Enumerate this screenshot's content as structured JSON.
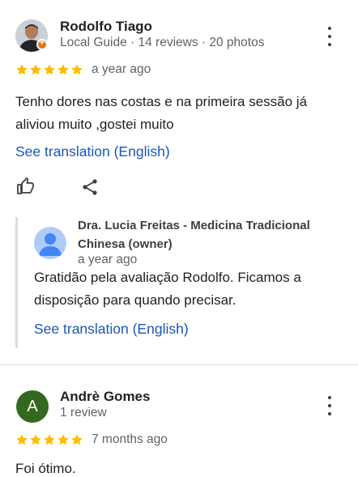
{
  "reviews": [
    {
      "name": "Rodolfo Tiago",
      "meta": "Local Guide · 14 reviews · 20 photos",
      "rating": 5,
      "time": "a year ago",
      "text": "Tenho dores nas costas e na primeira sessão já aliviou muito ,gostei muito",
      "translate": "See translation (English)",
      "owner_reply": {
        "name": "Dra. Lucia Freitas - Medicina Tradicional Chinesa (owner)",
        "time": "a year ago",
        "text": "Gratidão pela avaliação Rodolfo. Ficamos a disposição para quando precisar.",
        "translate": "See translation (English)"
      }
    },
    {
      "name": "Andrè Gomes",
      "avatar_letter": "A",
      "meta": "1 review",
      "rating": 5,
      "time": "7 months ago",
      "text": "Foi ótimo."
    }
  ],
  "colors": {
    "star": "#fbbc04",
    "link": "#1a56b8",
    "letter_avatar": "#33691e",
    "guide_badge": "#e8710a"
  },
  "icons": [
    "more-vert-icon",
    "thumb-up-icon",
    "share-icon",
    "star-icon",
    "person-icon",
    "local-guide-badge-icon"
  ]
}
